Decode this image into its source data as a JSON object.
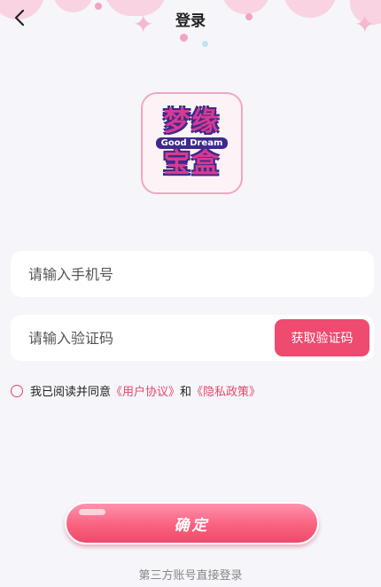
{
  "header": {
    "title": "登录",
    "back_icon": "chevron-left-icon"
  },
  "logo": {
    "line1": "梦缘",
    "english": "Good Dream",
    "line2": "宝盒"
  },
  "form": {
    "phone_placeholder": "请输入手机号",
    "code_placeholder": "请输入验证码",
    "get_code_label": "获取验证码"
  },
  "agreement": {
    "prefix": "我已阅读并同意",
    "user_agreement": "《用户协议》",
    "conjunction": "和",
    "privacy_policy": "《隐私政策》"
  },
  "confirm_label": "确定",
  "third_party_label": "第三方账号直接登录",
  "colors": {
    "accent": "#ef4a6f",
    "background": "#f5f5fa",
    "deco_pink": "#f9d3e2"
  }
}
